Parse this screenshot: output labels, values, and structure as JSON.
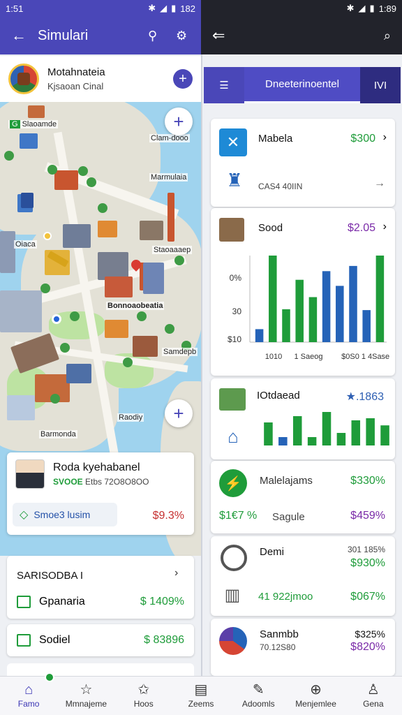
{
  "status_left": {
    "time": "1:51",
    "battery": "182"
  },
  "status_right": {
    "battery": "1:89"
  },
  "left_appbar": {
    "title": "Simulari"
  },
  "location_card": {
    "title": "Motahnateia",
    "subtitle": "Kjsaoan Cinal"
  },
  "map_labels": {
    "l1": "Slaoamde",
    "l2": "Clam-dooo",
    "l3": "Marmulaia",
    "l4": "Oiaca",
    "l5": "Staoaaaep",
    "l6": "Bonnoaobeatia",
    "l7": "Samdepb",
    "l8": "Raodiy",
    "l9": "Barmonda"
  },
  "profile_card": {
    "name": "Roda kyehabanel",
    "detail_green": "SVOOE",
    "detail_rest": "Etbs  72O8O8OO",
    "pill_label": "Smoe3 lusim",
    "value": "$9.3%"
  },
  "summary": {
    "header": "SARISODBA I",
    "rows": [
      {
        "label": "Gpanaria",
        "value": "$ 1409%"
      },
      {
        "label": "Sodiel",
        "value": "$ 83896"
      }
    ]
  },
  "right_tabs": {
    "active": "Dneeterinoentel",
    "other": "IVI"
  },
  "right_cards": {
    "c1": {
      "title": "Mabela",
      "value": "$300",
      "sub": "CAS4 40IIN"
    },
    "c2": {
      "title": "Sood",
      "value": "$2.05"
    },
    "c3": {
      "title": "IOtdaead",
      "value": "★.1863"
    },
    "c4": {
      "title": "Malelajams",
      "value": "$330%",
      "sub_left": "$1€7 %",
      "sub_mid": "Sagule",
      "sub_value": "$459%"
    },
    "c5": {
      "title": "Demi",
      "value_top": "301 185%",
      "value": "$930%",
      "sub_left": "41 922jmoo",
      "sub_value": "$067%"
    },
    "c6": {
      "title": "Sanmbb",
      "sub": "70.12S80",
      "value_top": "$325%",
      "value": "$820%"
    }
  },
  "bottom_nav": [
    {
      "label": "Famo",
      "icon": "home-icon"
    },
    {
      "label": "Mmnajeme",
      "icon": "star-icon"
    },
    {
      "label": "Hoos",
      "icon": "star-outline-icon"
    },
    {
      "label": "Zeems",
      "icon": "list-icon"
    },
    {
      "label": "Adoomls",
      "icon": "note-icon"
    },
    {
      "label": "Menjemlee",
      "icon": "compass-icon"
    },
    {
      "label": "Gena",
      "icon": "person-icon"
    }
  ],
  "colors": {
    "primary": "#4a47b8",
    "dark": "#22232b",
    "green": "#1f9c3a",
    "blue": "#2563b8"
  },
  "chart_data": [
    {
      "type": "bar",
      "ylabel_ticks": [
        "0%",
        "30",
        "$10"
      ],
      "xlabels": [
        "1010",
        "1 Saeog",
        "$0S0",
        "1 4Sase"
      ],
      "series": [
        {
          "values": [
            15,
            100,
            38,
            72,
            52,
            82,
            65,
            88,
            37,
            100
          ]
        }
      ],
      "bar_colors": [
        "blue",
        "green",
        "green",
        "green",
        "green",
        "blue",
        "blue",
        "blue",
        "blue",
        "green"
      ]
    },
    {
      "type": "bar",
      "series": [
        {
          "values": [
            55,
            20,
            70,
            20,
            80,
            30,
            60,
            65,
            48
          ]
        }
      ],
      "bar_colors": [
        "green",
        "blue",
        "green",
        "green",
        "green",
        "green",
        "green",
        "green",
        "green"
      ]
    }
  ]
}
